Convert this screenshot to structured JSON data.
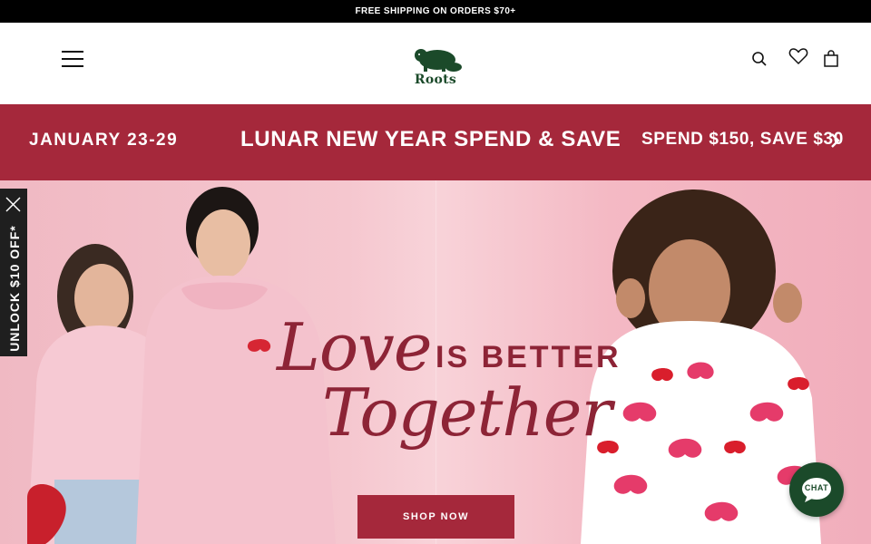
{
  "topbar": {
    "text": "FREE SHIPPING ON ORDERS $70+"
  },
  "header": {
    "logo_text": "Roots",
    "icons": [
      "menu-icon",
      "search-icon",
      "heart-icon",
      "bag-icon"
    ]
  },
  "promo": {
    "dates": "JANUARY 23-29",
    "title": "LUNAR NEW YEAR SPEND & SAVE",
    "offer": "SPEND $150, SAVE $30"
  },
  "hero": {
    "love": "Love",
    "is_better": "IS BETTER",
    "together": "Together",
    "cta": "SHOP NOW"
  },
  "side_tab": {
    "label": "UNLOCK $10 OFF*"
  },
  "chat": {
    "label": "CHAT"
  },
  "colors": {
    "brand_red": "#a5283b",
    "brand_green": "#1b4a2a",
    "hero_text": "#8d2436"
  }
}
